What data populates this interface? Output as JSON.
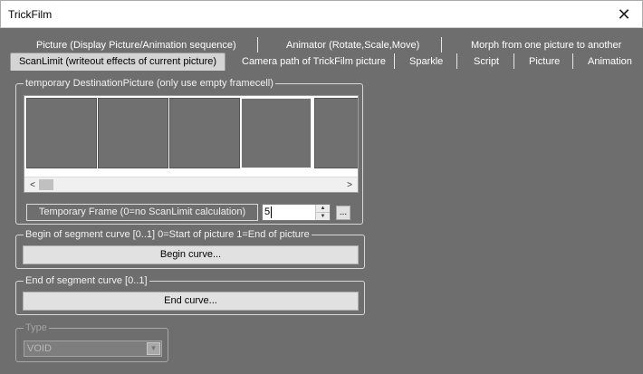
{
  "window": {
    "title": "TrickFilm",
    "close_glyph": "✕"
  },
  "tabs": {
    "row1": [
      {
        "label": "Picture (Display Picture/Animation sequence)"
      },
      {
        "label": "Animator (Rotate,Scale,Move)"
      },
      {
        "label": "Morph from one picture to another"
      }
    ],
    "row2": [
      {
        "label": "ScanLimit (writeout effects of current picture)",
        "active": true
      },
      {
        "label": "Camera path of TrickFilm picture"
      },
      {
        "label": "Sparkle"
      },
      {
        "label": "Script"
      },
      {
        "label": "Picture"
      },
      {
        "label": "Animation"
      }
    ]
  },
  "dest_group": {
    "legend": "temporary DestinationPicture (only use empty framecell)",
    "scroll_left": "<",
    "scroll_right": ">",
    "temp_frame_label": "Temporary Frame (0=no ScanLimit calculation)",
    "temp_frame_value": "5",
    "browse_label": "..."
  },
  "begin_group": {
    "legend": "Begin of segment curve [0..1] 0=Start of picture 1=End of picture",
    "button_label": "Begin curve..."
  },
  "end_group": {
    "legend": "End of segment curve [0..1]",
    "button_label": "End curve..."
  },
  "type_group": {
    "legend": "Type",
    "selected": "VOID"
  },
  "colors": {
    "background": "#6e6e6e",
    "titlebar": "#ffffff",
    "button": "#e1e1e1"
  },
  "icons": {
    "close": "close-icon",
    "spin_up": "triangle-up-icon",
    "spin_down": "triangle-down-icon",
    "dropdown": "chevron-down-icon"
  }
}
